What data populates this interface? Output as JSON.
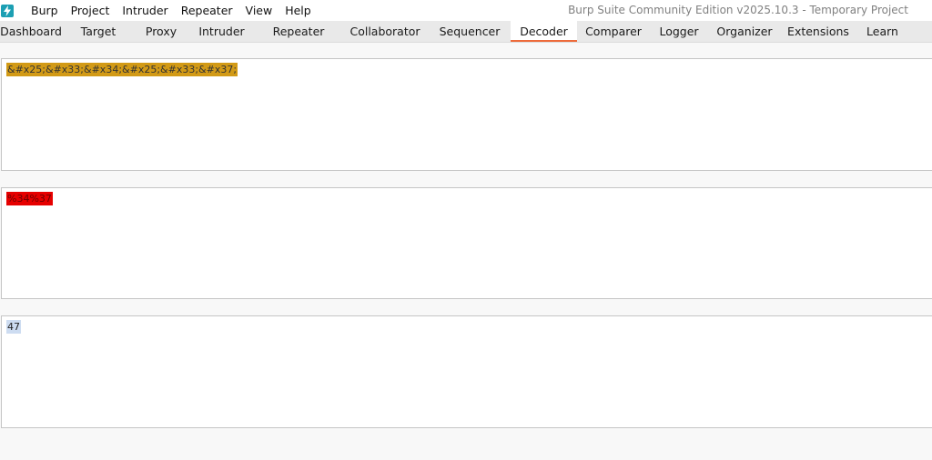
{
  "menubar": {
    "icon": "burp-lightning-icon",
    "items": [
      "Burp",
      "Project",
      "Intruder",
      "Repeater",
      "View",
      "Help"
    ],
    "title": "Burp Suite Community Edition v2025.10.3 - Temporary Project"
  },
  "tabs": {
    "items": [
      {
        "label": "Dashboard"
      },
      {
        "label": "Target"
      },
      {
        "label": "Proxy"
      },
      {
        "label": "Intruder"
      },
      {
        "label": "Repeater"
      },
      {
        "label": "Collaborator"
      },
      {
        "label": "Sequencer"
      },
      {
        "label": "Decoder"
      },
      {
        "label": "Comparer"
      },
      {
        "label": "Logger"
      },
      {
        "label": "Organizer"
      },
      {
        "label": "Extensions"
      },
      {
        "label": "Learn"
      }
    ],
    "active": "Decoder",
    "accent_color": "#ee6b3b"
  },
  "decoder": {
    "panels": [
      {
        "text": "&#x25;&#x33;&#x34;&#x25;&#x33;&#x37;",
        "highlight": "#d29a16"
      },
      {
        "text": "%34%37",
        "highlight": "#e60000"
      },
      {
        "text": "47",
        "highlight": "#cddcf1"
      }
    ]
  }
}
